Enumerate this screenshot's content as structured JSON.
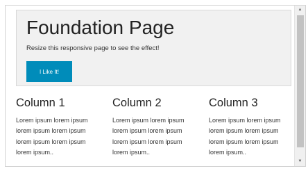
{
  "jumbotron": {
    "title": "Foundation Page",
    "subtitle": "Resize this responsive page to see the effect!",
    "button_label": "I Like It!"
  },
  "columns": [
    {
      "title": "Column 1",
      "text": "Lorem ipsum lorem ipsum lorem ipsum lorem ipsum lorem ipsum lorem ipsum lorem ipsum.."
    },
    {
      "title": "Column 2",
      "text": "Lorem ipsum lorem ipsum lorem ipsum lorem ipsum lorem ipsum lorem ipsum lorem ipsum.."
    },
    {
      "title": "Column 3",
      "text": "Lorem ipsum lorem ipsum lorem ipsum lorem ipsum lorem ipsum lorem ipsum lorem ipsum.."
    }
  ],
  "scrollbar": {
    "up_icon": "triangle-up",
    "down_icon": "triangle-down"
  },
  "colors": {
    "button": "#008cba",
    "jumbotron_bg": "#f1f1f1"
  }
}
